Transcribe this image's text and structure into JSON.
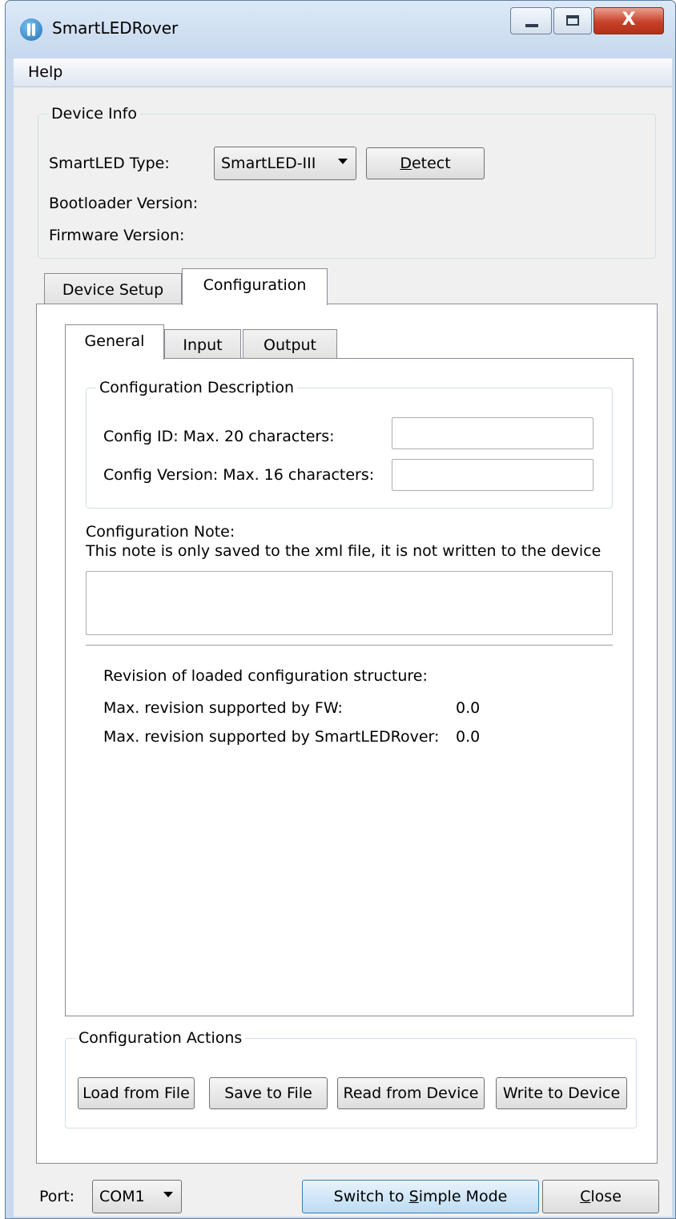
{
  "window": {
    "title": "SmartLEDRover",
    "close_glyph": "X"
  },
  "menu": {
    "help": "Help"
  },
  "device_info": {
    "legend": "Device Info",
    "type_label": "SmartLED Type:",
    "type_value": "SmartLED-III",
    "detect_pre": "",
    "detect_key": "D",
    "detect_post": "etect",
    "bootloader_label": "Bootloader Version:",
    "firmware_label": "Firmware Version:"
  },
  "tabs": {
    "device_setup": "Device Setup",
    "configuration": "Configuration"
  },
  "subtabs": {
    "general": "General",
    "input": "Input",
    "output": "Output"
  },
  "config_desc": {
    "legend": "Configuration Description",
    "id_label": "Config ID: Max. 20 characters:",
    "id_value": "",
    "version_label": "Config Version: Max. 16 characters:",
    "version_value": ""
  },
  "note": {
    "title": "Configuration Note:",
    "hint": "This note is only saved to the xml file, it is not written to the device",
    "value": ""
  },
  "revision": {
    "loaded_label": "Revision of loaded configuration structure:",
    "loaded_value": "",
    "fw_label": "Max. revision supported by FW:",
    "fw_value": "0.0",
    "rover_label": "Max. revision supported by SmartLEDRover:",
    "rover_value": "0.0"
  },
  "actions": {
    "legend": "Configuration Actions",
    "load": "Load from File",
    "save": "Save to File",
    "read": "Read from Device",
    "write": "Write to Device"
  },
  "footer": {
    "port_label": "Port:",
    "port_value": "COM1",
    "switch_pre": "Switch to ",
    "switch_key": "S",
    "switch_post": "imple Mode",
    "close_key": "C",
    "close_post": "lose"
  }
}
